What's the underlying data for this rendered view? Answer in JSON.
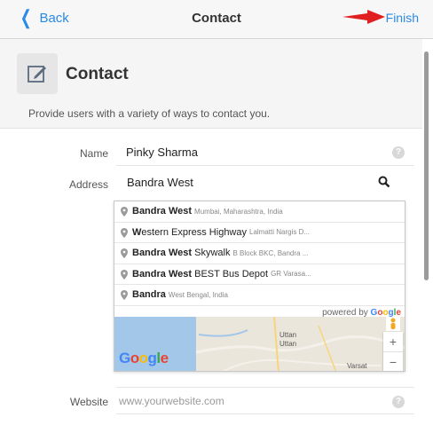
{
  "nav": {
    "back_label": "Back",
    "title": "Contact",
    "finish_label": "Finish"
  },
  "header": {
    "title": "Contact",
    "description": "Provide users with a variety of ways to contact you.",
    "icon": "edit-icon"
  },
  "form": {
    "name": {
      "label": "Name",
      "value": "Pinky Sharma"
    },
    "address": {
      "label": "Address",
      "value": "Bandra West"
    },
    "website": {
      "label": "Website",
      "placeholder": "www.yourwebsite.com"
    }
  },
  "autocomplete": {
    "suggestions": [
      {
        "bold": "Bandra West",
        "rest": "",
        "secondary": "Mumbai, Maharashtra, India"
      },
      {
        "bold": "W",
        "rest": "estern Express Highway",
        "secondary": "Lalmatti Nargis D..."
      },
      {
        "bold": "Bandra West",
        "rest": " Skywalk",
        "secondary": "B Block BKC, Bandra ..."
      },
      {
        "bold": "Bandra West",
        "rest": " BEST Bus Depot",
        "secondary": "GR Varasa..."
      },
      {
        "bold": "Bandra",
        "rest": "",
        "secondary": "West Bengal, India"
      }
    ],
    "powered_by": "powered by",
    "map": {
      "labels": [
        "Uttan",
        "Uttan",
        "Varsat"
      ]
    }
  },
  "colors": {
    "accent": "#2a8ae6",
    "arrow": "#e02020"
  }
}
